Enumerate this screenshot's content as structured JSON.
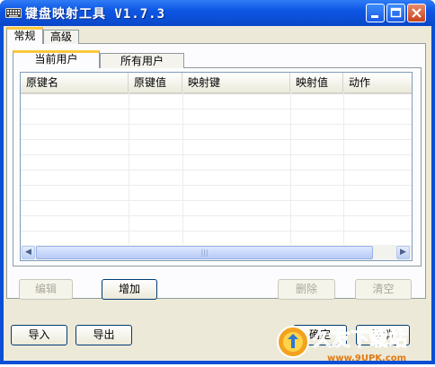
{
  "window": {
    "title": "键盘映射工具 V1.7.3"
  },
  "outer_tabs": [
    {
      "label": "常规",
      "active": true
    },
    {
      "label": "高级",
      "active": false
    }
  ],
  "inner_tabs": [
    {
      "label": "当前用户",
      "active": true
    },
    {
      "label": "所有用户",
      "active": false
    }
  ],
  "table": {
    "columns": [
      "原键名",
      "原键值",
      "映射键",
      "映射值",
      "动作"
    ],
    "rows": []
  },
  "row_buttons": {
    "edit": "编辑",
    "add": "增加",
    "delete": "删除",
    "clear": "清空"
  },
  "bottom_buttons": {
    "import": "导入",
    "export": "导出",
    "ok": "确定",
    "cancel": "取消"
  },
  "watermark": {
    "brand": "久友下载站",
    "url": "www.9UPK.com"
  },
  "colors": {
    "titlebar": "#0a56e4",
    "face": "#ece9d8",
    "active_tab_accent": "#ffc83c",
    "close_button": "#d4502a"
  }
}
